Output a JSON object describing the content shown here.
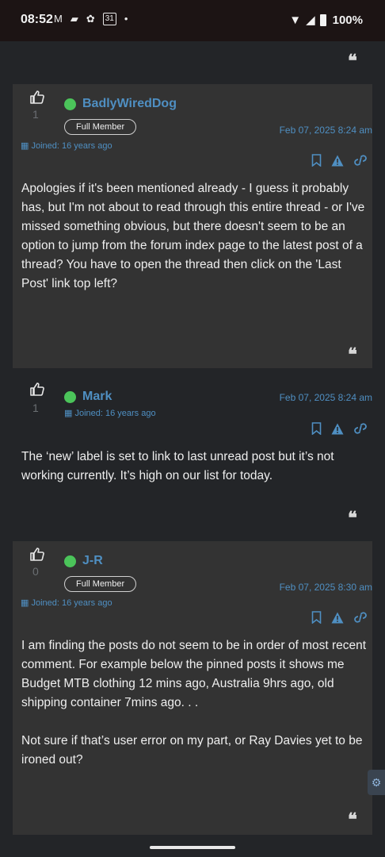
{
  "status_bar": {
    "time": "08:52",
    "battery": "100%",
    "calendar_day": "31"
  },
  "icons": {
    "quote": "quote-icon",
    "thumbs_up": "thumbs-up-icon",
    "bookmark": "bookmark-icon",
    "report": "warning-icon",
    "link": "link-icon",
    "calendar": "calendar-icon",
    "settings": "gear-icon"
  },
  "colors": {
    "accent": "#4f8fc2",
    "online": "#4bc45a",
    "background": "#232528",
    "card": "#333333"
  },
  "posts": [
    {
      "likes": "1",
      "username": "BadlyWiredDog",
      "rank": "Full Member",
      "joined": "Joined: 16 years ago",
      "date": "Feb 07, 2025 8:24 am",
      "body": [
        "Apologies if it's been mentioned already - I guess it probably has, but I'm not about to read through this entire thread -  or I've missed something obvious, but there doesn't seem to be an option to jump from the forum index page to the latest post of a thread? You have to open the thread then click on the 'Last Post' link top left?"
      ]
    },
    {
      "likes": "1",
      "username": "Mark",
      "rank": "",
      "joined": "Joined: 16 years ago",
      "date": "Feb 07, 2025 8:24 am",
      "body": [
        "The ‘new’ label is set to link to last unread post but it’s not working currently. It’s high on our list for today."
      ]
    },
    {
      "likes": "0",
      "username": "J-R",
      "rank": "Full Member",
      "joined": "Joined: 16 years ago",
      "date": "Feb 07, 2025 8:30 am",
      "body": [
        "I am finding the posts do not seem to be in order of most recent comment. For example below the pinned posts it shows me Budget MTB clothing 12 mins ago, Australia 9hrs ago, old shipping container  7mins ago. . .",
        "Not sure if that’s user error on my part, or Ray Davies yet to be ironed out?"
      ]
    }
  ]
}
